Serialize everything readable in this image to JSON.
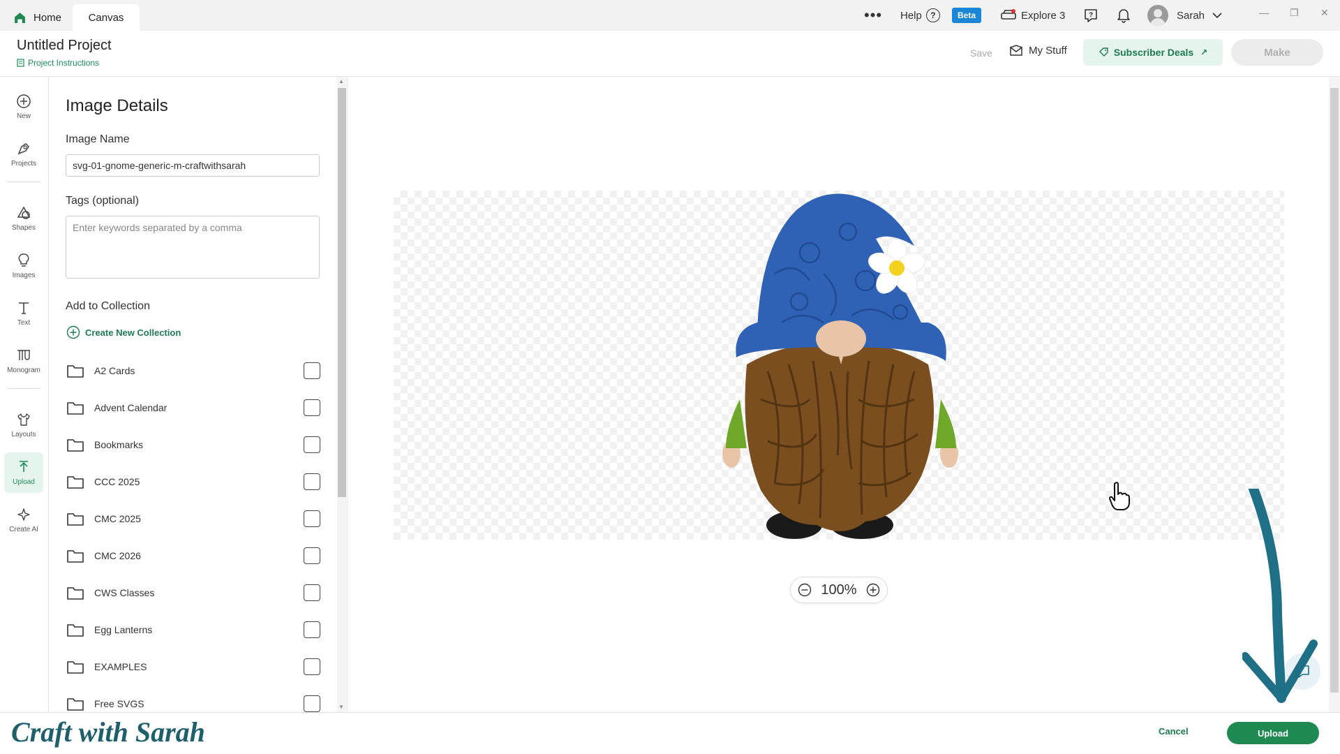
{
  "tabs": {
    "home": "Home",
    "canvas": "Canvas"
  },
  "topbar": {
    "more": "•••",
    "help": "Help",
    "help_q": "?",
    "beta": "Beta",
    "explore": "Explore 3",
    "user": "Sarah"
  },
  "project": {
    "title": "Untitled Project",
    "instructions": "Project Instructions",
    "save": "Save",
    "my_stuff": "My Stuff",
    "deals": "Subscriber Deals",
    "make": "Make"
  },
  "rail": {
    "new": "New",
    "projects": "Projects",
    "shapes": "Shapes",
    "images": "Images",
    "text": "Text",
    "monogram": "Monogram",
    "layouts": "Layouts",
    "upload": "Upload",
    "create_ai": "Create AI"
  },
  "panel": {
    "title": "Image Details",
    "image_name_label": "Image Name",
    "image_name_value": "svg-01-gnome-generic-m-craftwithsarah",
    "tags_label": "Tags (optional)",
    "tags_placeholder": "Enter keywords separated by a comma",
    "collection_label": "Add to Collection",
    "create_collection": "Create New Collection",
    "collections": [
      "A2 Cards",
      "Advent Calendar",
      "Bookmarks",
      "CCC 2025",
      "CMC 2025",
      "CMC 2026",
      "CWS Classes",
      "Egg Lanterns",
      "EXAMPLES",
      "Free SVGS"
    ]
  },
  "canvas": {
    "zoom": "100%"
  },
  "footer": {
    "watermark": "Craft with Sarah",
    "cancel": "Cancel",
    "upload": "Upload"
  },
  "colors": {
    "accent": "#1e8a52",
    "beta": "#1b86d8",
    "annotation_arrow": "#1f6f86",
    "hat": "#2f62b4",
    "beard": "#7a4e1f"
  }
}
